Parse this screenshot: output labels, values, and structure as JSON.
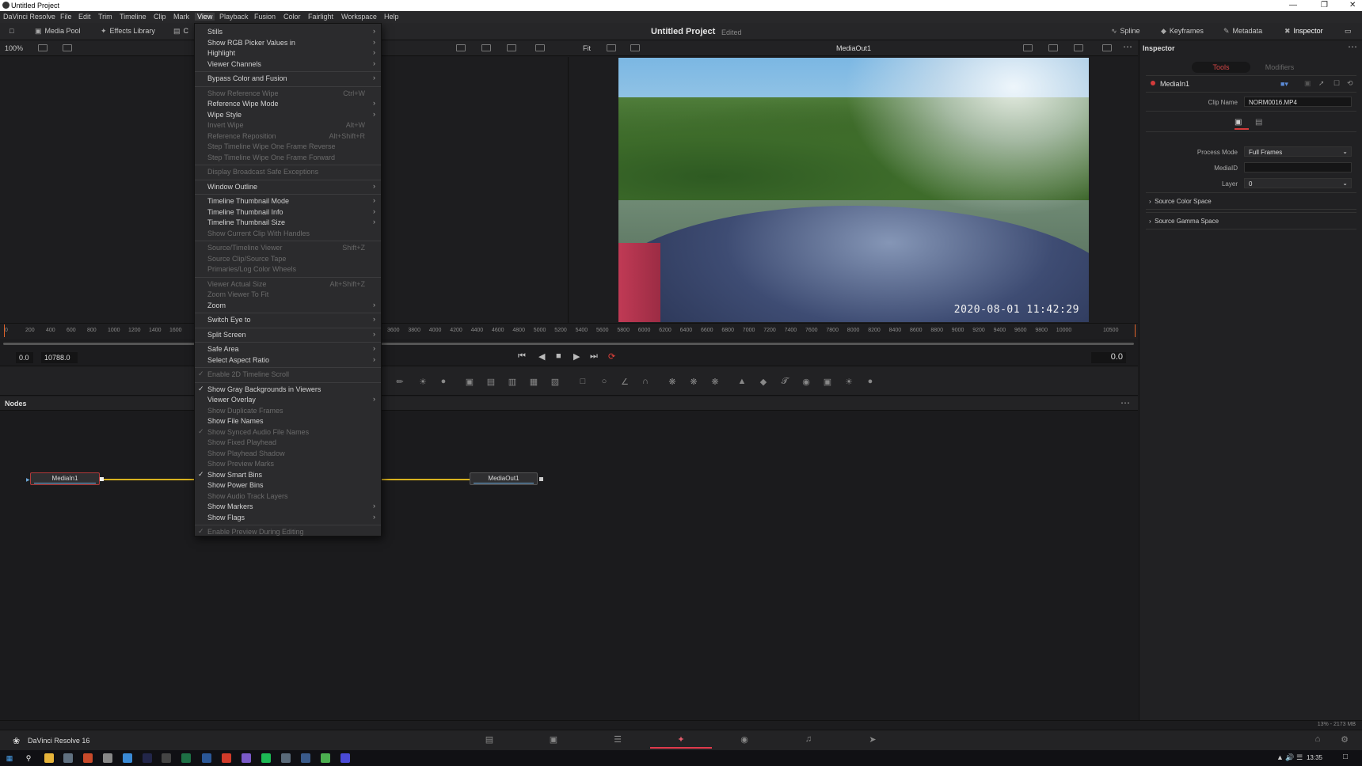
{
  "window": {
    "title": "Untitled Project"
  },
  "menubar": [
    "DaVinci Resolve",
    "File",
    "Edit",
    "Trim",
    "Timeline",
    "Clip",
    "Mark",
    "View",
    "Playback",
    "Fusion",
    "Color",
    "Fairlight",
    "Workspace",
    "Help"
  ],
  "toolbar": {
    "left": [
      {
        "label": "Media Pool",
        "icon": "media-pool-icon"
      },
      {
        "label": "Effects Library",
        "icon": "effects-library-icon"
      },
      {
        "label": "C",
        "icon": "clips-icon"
      }
    ],
    "project_title": "Untitled Project",
    "project_status": "Edited",
    "right": [
      {
        "label": "Spline",
        "icon": "spline-icon"
      },
      {
        "label": "Keyframes",
        "icon": "keyframes-icon"
      },
      {
        "label": "Metadata",
        "icon": "metadata-icon"
      },
      {
        "label": "Inspector",
        "icon": "inspector-icon"
      }
    ]
  },
  "viewer": {
    "zoom_left": "100%",
    "fit_label": "Fit",
    "name": "MediaOut1",
    "timestamp": "2020-08-01 11:42:29"
  },
  "ruler": {
    "ticks": [
      "0",
      "200",
      "400",
      "600",
      "800",
      "1000",
      "1200",
      "1400",
      "1600",
      "3600",
      "3800",
      "4000",
      "4200",
      "4400",
      "4600",
      "4800",
      "5000",
      "5200",
      "5400",
      "5600",
      "5800",
      "6000",
      "6200",
      "6400",
      "6600",
      "6800",
      "7000",
      "7200",
      "7400",
      "7600",
      "7800",
      "8000",
      "8200",
      "8400",
      "8600",
      "8800",
      "9000",
      "9200",
      "9400",
      "9600",
      "9800",
      "10000",
      "10500"
    ]
  },
  "transport": {
    "start": "0.0",
    "end": "10788.0",
    "current": "0.0"
  },
  "nodes": {
    "title": "Nodes",
    "items": [
      {
        "name": "MediaIn1"
      },
      {
        "name": "MediaOut1"
      }
    ]
  },
  "inspector": {
    "title": "Inspector",
    "tabs": [
      "Tools",
      "Modifiers"
    ],
    "node_name": "MediaIn1",
    "fields": {
      "clip_name_label": "Clip Name",
      "clip_name_value": "NORM0016.MP4",
      "process_mode_label": "Process Mode",
      "process_mode_value": "Full Frames",
      "mediaid_label": "MediaID",
      "mediaid_value": "",
      "layer_label": "Layer",
      "layer_value": "0"
    },
    "sections": [
      "Source Color Space",
      "Source Gamma Space"
    ]
  },
  "status": {
    "memory": "13% - 2173 MB"
  },
  "pagebar": {
    "app": "DaVinci Resolve 16",
    "active_page": "Fusion"
  },
  "taskbar": {
    "time": "13:35"
  },
  "view_menu": {
    "items": [
      {
        "label": "Stills",
        "arrow": true
      },
      {
        "label": "Show RGB Picker Values in",
        "arrow": true
      },
      {
        "label": "Highlight",
        "arrow": true
      },
      {
        "label": "Viewer Channels",
        "arrow": true
      },
      {
        "sep": true
      },
      {
        "label": "Bypass Color and Fusion",
        "arrow": true
      },
      {
        "sep": true
      },
      {
        "label": "Show Reference Wipe",
        "shortcut": "Ctrl+W",
        "disabled": true
      },
      {
        "label": "Reference Wipe Mode",
        "arrow": true
      },
      {
        "label": "Wipe Style",
        "arrow": true
      },
      {
        "label": "Invert Wipe",
        "shortcut": "Alt+W",
        "disabled": true
      },
      {
        "label": "Reference Reposition",
        "shortcut": "Alt+Shift+R",
        "disabled": true
      },
      {
        "label": "Step Timeline Wipe One Frame Reverse",
        "disabled": true
      },
      {
        "label": "Step Timeline Wipe One Frame Forward",
        "disabled": true
      },
      {
        "sep": true
      },
      {
        "label": "Display Broadcast Safe Exceptions",
        "disabled": true
      },
      {
        "sep": true
      },
      {
        "label": "Window Outline",
        "arrow": true
      },
      {
        "sep": true
      },
      {
        "label": "Timeline Thumbnail Mode",
        "arrow": true
      },
      {
        "label": "Timeline Thumbnail Info",
        "arrow": true
      },
      {
        "label": "Timeline Thumbnail Size",
        "arrow": true
      },
      {
        "label": "Show Current Clip With Handles",
        "disabled": true
      },
      {
        "sep": true
      },
      {
        "label": "Source/Timeline Viewer",
        "shortcut": "Shift+Z",
        "disabled": true
      },
      {
        "label": "Source Clip/Source Tape",
        "disabled": true
      },
      {
        "label": "Primaries/Log Color Wheels",
        "disabled": true
      },
      {
        "sep": true
      },
      {
        "label": "Viewer Actual Size",
        "shortcut": "Alt+Shift+Z",
        "disabled": true
      },
      {
        "label": "Zoom Viewer To Fit",
        "disabled": true
      },
      {
        "label": "Zoom",
        "arrow": true
      },
      {
        "sep": true
      },
      {
        "label": "Switch Eye to",
        "arrow": true
      },
      {
        "sep": true
      },
      {
        "label": "Split Screen",
        "arrow": true
      },
      {
        "sep": true
      },
      {
        "label": "Safe Area",
        "arrow": true
      },
      {
        "label": "Select Aspect Ratio",
        "arrow": true
      },
      {
        "sep": true
      },
      {
        "label": "Enable 2D Timeline Scroll",
        "checked": true,
        "disabled": true
      },
      {
        "sep": true
      },
      {
        "label": "Show Gray Backgrounds in Viewers",
        "checked": true
      },
      {
        "label": "Viewer Overlay",
        "arrow": true
      },
      {
        "label": "Show Duplicate Frames",
        "disabled": true
      },
      {
        "label": "Show File Names"
      },
      {
        "label": "Show Synced Audio File Names",
        "checked": true,
        "disabled": true
      },
      {
        "label": "Show Fixed Playhead",
        "disabled": true
      },
      {
        "label": "Show Playhead Shadow",
        "disabled": true
      },
      {
        "label": "Show Preview Marks",
        "disabled": true
      },
      {
        "label": "Show Smart Bins",
        "checked": true
      },
      {
        "label": "Show Power Bins"
      },
      {
        "label": "Show Audio Track Layers",
        "disabled": true
      },
      {
        "label": "Show Markers",
        "arrow": true
      },
      {
        "label": "Show Flags",
        "arrow": true
      },
      {
        "sep": true
      },
      {
        "label": "Enable Preview During Editing",
        "checked": true,
        "disabled": true
      }
    ]
  }
}
